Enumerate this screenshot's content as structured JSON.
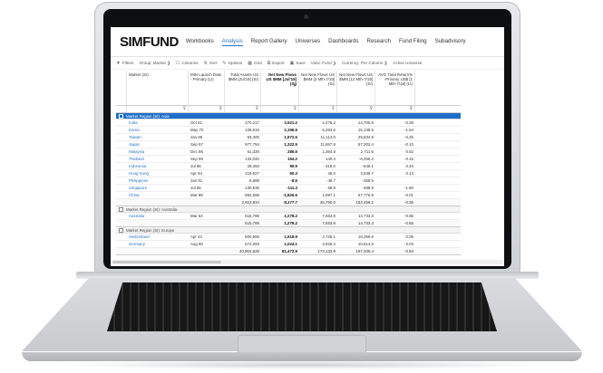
{
  "app": {
    "logo": "SIMFUND",
    "nav": [
      {
        "label": "Workbooks",
        "active": false
      },
      {
        "label": "Analysis",
        "active": true
      },
      {
        "label": "Report Gallery",
        "active": false
      },
      {
        "label": "Universes",
        "active": false
      },
      {
        "label": "Dashboards",
        "active": false
      },
      {
        "label": "Research",
        "active": false
      },
      {
        "label": "Fund Filing",
        "active": false
      },
      {
        "label": "Subadvisory",
        "active": false
      }
    ],
    "toolbar": [
      {
        "label": "Filters",
        "icon": "filter-icon"
      },
      {
        "label": "Group: Market ❯",
        "icon": ""
      },
      {
        "label": "Columns",
        "icon": "columns-icon"
      },
      {
        "label": "Sort",
        "icon": "sort-icon"
      },
      {
        "label": "Options",
        "icon": "wrench-icon"
      },
      {
        "label": "Grid",
        "icon": "grid-icon"
      },
      {
        "label": "Export",
        "icon": "export-icon"
      },
      {
        "label": "Save",
        "icon": "save-icon"
      },
      {
        "label": "View: Fund ❯",
        "icon": ""
      },
      {
        "label": "Currency: Per Column ❯",
        "icon": ""
      },
      {
        "label": "Active Universe",
        "icon": ""
      }
    ]
  },
  "table": {
    "headers": [
      {
        "label": "Market (SI)",
        "bold": false
      },
      {
        "label": "MIN Launch Date - Primary (LI)",
        "bold": false
      },
      {
        "label": "Total Assets US $MM [Jul'19] (SI)",
        "bold": false
      },
      {
        "label": "Net New Flows US $MM [Jul'19] (SI)",
        "bold": true
      },
      {
        "label": "Net New Flows US $MM [3 Mth-7/19] (SI)",
        "bold": false
      },
      {
        "label": "Net New Flows US $MM [12 Mth-7/19] (SI)",
        "bold": false
      },
      {
        "label": "AVG Total Return% -Primary US$ [1 Mth-7/19] (LI)",
        "bold": false
      }
    ],
    "groups": [
      {
        "label": "Market Region (SI): Asia",
        "highlight": true,
        "rows": [
          [
            "India",
            "Oct 61",
            "270,217",
            "3,521.2",
            "4,278.2",
            "14,705.5",
            "-0.38"
          ],
          [
            "Korea",
            "May 70",
            "108,915",
            "2,196.9",
            "6,253.6",
            "15,138.5",
            "-1.64"
          ],
          [
            "Taiwan",
            "Jan 86",
            "93,400",
            "1,972.5",
            "11,113.0",
            "29,834.9",
            "-0.25"
          ],
          [
            "Japan",
            "Sep 57",
            "977,794",
            "1,322.5",
            "11,867.8",
            "57,302.4",
            "-0.10"
          ],
          [
            "Malaysia",
            "Dec 86",
            "61,330",
            "286.6",
            "1,364.8",
            "2,711.6",
            "0.62"
          ],
          [
            "Thailand",
            "Sep 86",
            "133,040",
            "194.2",
            "140.4",
            "-6,255.2",
            "-0.16"
          ],
          [
            "Indonesia",
            "Jul 96",
            "29,393",
            "99.9",
            "-318.0",
            "-546.1",
            "0.34"
          ],
          [
            "Hong Kong",
            "Apr 84",
            "216,927",
            "60.3",
            "46.0",
            "3,639.7",
            "0.13"
          ],
          [
            "Philippines",
            "Jan 91",
            "8,688",
            "-8.6",
            "-48.7",
            "-358.5",
            ""
          ],
          [
            "Singapore",
            "Jul 65",
            "130,530",
            "-111.3",
            "68.9",
            "-488.9",
            "-1.90"
          ],
          [
            "China",
            "Mar 98",
            "892,696",
            "-1,826.5",
            "1,997.1",
            "67,776.9",
            "-0.01"
          ]
        ],
        "subtotal": [
          "",
          "",
          "2,922,934",
          "8,177.7",
          "36,760.0",
          "184,456.2",
          "-0.36"
        ]
      },
      {
        "label": "Market Region (SI): Australia",
        "highlight": false,
        "rows": [
          [
            "Australia",
            "Mar 64",
            "515,786",
            "1,278.2",
            "7,553.8",
            "14,733.3",
            "-0.65"
          ]
        ],
        "subtotal": [
          "",
          "",
          "515,786",
          "1,278.2",
          "7,553.8",
          "14,733.3",
          "-0.65"
        ]
      },
      {
        "label": "Market Region (SI): Europe",
        "highlight": false,
        "rows": [
          [
            "Switzerland",
            "Apr 43",
            "600,906",
            "1,918.9",
            "2,729.1",
            "18,359.6",
            "-2.05"
          ],
          [
            "Germany",
            "Aug 80",
            "672,293",
            "1,024.1",
            "3,926.4",
            "10,614.6",
            "-2.03"
          ]
        ],
        "subtotal": [
          "",
          "",
          "40,904,626",
          "81,472.9",
          "173,132.9",
          "197,406.4",
          "-0.84"
        ]
      }
    ]
  },
  "colors": {
    "accent": "#1e6fc9",
    "link": "#2a74c9"
  }
}
